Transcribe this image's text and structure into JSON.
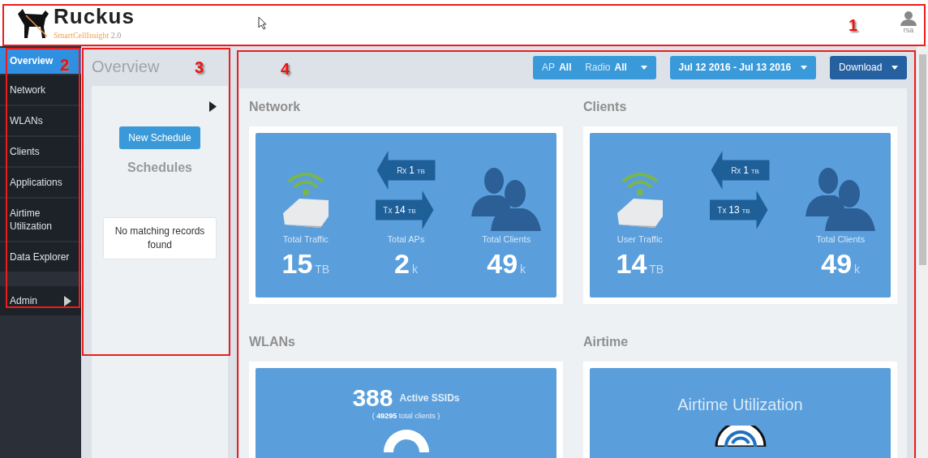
{
  "header": {
    "brand": "Ruckus",
    "product": "SmartCellInsight",
    "version": "2.0",
    "user": "rsa"
  },
  "sidebar": {
    "items": [
      {
        "label": "Overview",
        "selected": true
      },
      {
        "label": "Network",
        "selected": false
      },
      {
        "label": "WLANs",
        "selected": false
      },
      {
        "label": "Clients",
        "selected": false
      },
      {
        "label": "Applications",
        "selected": false
      },
      {
        "label": "Airtime Utilization",
        "selected": false
      },
      {
        "label": "Data Explorer",
        "selected": false
      }
    ],
    "admin": {
      "label": "Admin",
      "selected": false
    }
  },
  "schedules_panel": {
    "title": "Overview",
    "button": "New Schedule",
    "heading": "Schedules",
    "empty_message": "No matching records found"
  },
  "toolbar": {
    "ap_label": "AP",
    "ap_value": "All",
    "radio_label": "Radio",
    "radio_value": "All",
    "date_range": "Jul 12 2016 - Jul 13 2016",
    "download": "Download"
  },
  "sections": [
    {
      "title": "Network",
      "kind": "traffic",
      "rx": {
        "label": "Rx",
        "value": "1",
        "unit": "TB"
      },
      "tx": {
        "label": "Tx",
        "value": "14",
        "unit": "TB"
      },
      "stats": [
        {
          "kind": "device",
          "label": "Total Traffic",
          "value": "15",
          "unit": "TB"
        },
        {
          "kind": "plain",
          "label": "Total APs",
          "value": "2",
          "unit": "k"
        },
        {
          "kind": "people",
          "label": "Total Clients",
          "value": "49",
          "unit": "k"
        }
      ]
    },
    {
      "title": "Clients",
      "kind": "traffic",
      "rx": {
        "label": "Rx",
        "value": "1",
        "unit": "TB"
      },
      "tx": {
        "label": "Tx",
        "value": "13",
        "unit": "TB"
      },
      "stats": [
        {
          "kind": "device",
          "label": "User Traffic",
          "value": "14",
          "unit": "TB"
        },
        {
          "kind": "empty"
        },
        {
          "kind": "people",
          "label": "Total Clients",
          "value": "49",
          "unit": "k"
        }
      ]
    },
    {
      "title": "WLANs",
      "kind": "wlans",
      "count": "388",
      "count_label": "Active SSIDs",
      "subtitle": "( **49295** total clients )"
    },
    {
      "title": "Airtime",
      "kind": "airtime",
      "heading": "Airtime Utilization"
    }
  ],
  "annotations": [
    {
      "label": "1"
    },
    {
      "label": "2"
    },
    {
      "label": "3"
    },
    {
      "label": "4"
    }
  ]
}
